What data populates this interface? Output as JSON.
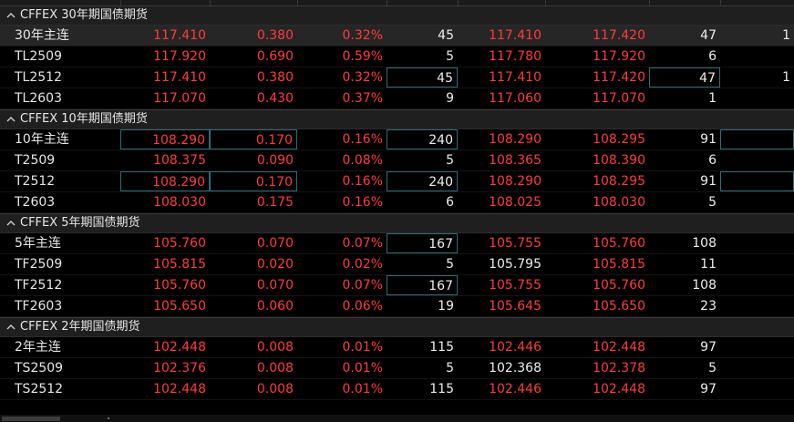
{
  "sections": [
    {
      "title": "CFFEX 30年期国债期货",
      "rows": [
        {
          "name": "30年主连",
          "c1": "117.410",
          "c2": "0.380",
          "c3": "0.32%",
          "c4": "45",
          "c5": "117.410",
          "c6": "117.420",
          "c7": "47",
          "c8": "1"
        },
        {
          "name": "TL2509",
          "c1": "117.920",
          "c2": "0.690",
          "c3": "0.59%",
          "c4": "5",
          "c5": "117.780",
          "c6": "117.920",
          "c7": "6",
          "c8": ""
        },
        {
          "name": "TL2512",
          "c1": "117.410",
          "c2": "0.380",
          "c3": "0.32%",
          "c4": "45",
          "c5": "117.410",
          "c6": "117.420",
          "c7": "47",
          "c8": "1"
        },
        {
          "name": "TL2603",
          "c1": "117.070",
          "c2": "0.430",
          "c3": "0.37%",
          "c4": "9",
          "c5": "117.060",
          "c6": "117.070",
          "c7": "1",
          "c8": ""
        }
      ]
    },
    {
      "title": "CFFEX 10年期国债期货",
      "rows": [
        {
          "name": "10年主连",
          "c1": "108.290",
          "c2": "0.170",
          "c3": "0.16%",
          "c4": "240",
          "c5": "108.290",
          "c6": "108.295",
          "c7": "91",
          "c8": ""
        },
        {
          "name": "T2509",
          "c1": "108.375",
          "c2": "0.090",
          "c3": "0.08%",
          "c4": "5",
          "c5": "108.365",
          "c6": "108.390",
          "c7": "6",
          "c8": ""
        },
        {
          "name": "T2512",
          "c1": "108.290",
          "c2": "0.170",
          "c3": "0.16%",
          "c4": "240",
          "c5": "108.290",
          "c6": "108.295",
          "c7": "91",
          "c8": ""
        },
        {
          "name": "T2603",
          "c1": "108.030",
          "c2": "0.175",
          "c3": "0.16%",
          "c4": "6",
          "c5": "108.025",
          "c6": "108.030",
          "c7": "5",
          "c8": ""
        }
      ]
    },
    {
      "title": "CFFEX 5年期国债期货",
      "rows": [
        {
          "name": "5年主连",
          "c1": "105.760",
          "c2": "0.070",
          "c3": "0.07%",
          "c4": "167",
          "c5": "105.755",
          "c6": "105.760",
          "c7": "108",
          "c8": ""
        },
        {
          "name": "TF2509",
          "c1": "105.815",
          "c2": "0.020",
          "c3": "0.02%",
          "c4": "5",
          "c5": "105.795",
          "c6": "105.815",
          "c7": "11",
          "c8": ""
        },
        {
          "name": "TF2512",
          "c1": "105.760",
          "c2": "0.070",
          "c3": "0.07%",
          "c4": "167",
          "c5": "105.755",
          "c6": "105.760",
          "c7": "108",
          "c8": ""
        },
        {
          "name": "TF2603",
          "c1": "105.650",
          "c2": "0.060",
          "c3": "0.06%",
          "c4": "19",
          "c5": "105.645",
          "c6": "105.650",
          "c7": "23",
          "c8": ""
        }
      ]
    },
    {
      "title": "CFFEX 2年期国债期货",
      "rows": [
        {
          "name": "2年主连",
          "c1": "102.448",
          "c2": "0.008",
          "c3": "0.01%",
          "c4": "115",
          "c5": "102.446",
          "c6": "102.448",
          "c7": "97",
          "c8": ""
        },
        {
          "name": "TS2509",
          "c1": "102.376",
          "c2": "0.008",
          "c3": "0.01%",
          "c4": "5",
          "c5": "102.368",
          "c6": "102.378",
          "c7": "5",
          "c8": ""
        },
        {
          "name": "TS2512",
          "c1": "102.448",
          "c2": "0.008",
          "c3": "0.01%",
          "c4": "115",
          "c5": "102.446",
          "c6": "102.448",
          "c7": "97",
          "c8": ""
        }
      ]
    }
  ],
  "colors": {
    "up": "#ff3b3b",
    "neutral": "#e6e6e6",
    "highlight_border": "#2d6d78",
    "background": "#000000"
  },
  "icons": {
    "collapse": "chevron-up-icon"
  }
}
